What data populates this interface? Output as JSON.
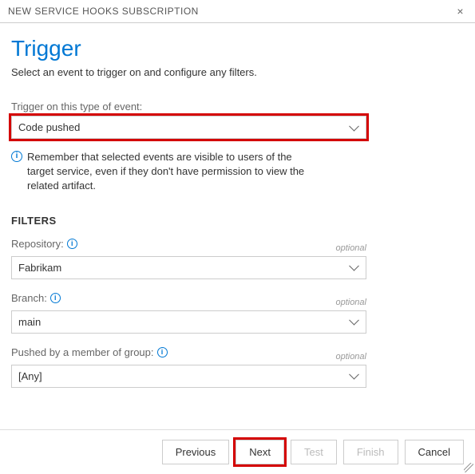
{
  "dialog": {
    "title": "NEW SERVICE HOOKS SUBSCRIPTION"
  },
  "header": {
    "title": "Trigger",
    "subtitle": "Select an event to trigger on and configure any filters."
  },
  "event": {
    "label": "Trigger on this type of event:",
    "value": "Code pushed",
    "info": "Remember that selected events are visible to users of the target service, even if they don't have permission to view the related artifact."
  },
  "filters": {
    "heading": "FILTERS",
    "optional_text": "optional",
    "repository": {
      "label": "Repository:",
      "value": "Fabrikam"
    },
    "branch": {
      "label": "Branch:",
      "value": "main"
    },
    "group": {
      "label": "Pushed by a member of group:",
      "value": "[Any]"
    }
  },
  "buttons": {
    "previous": "Previous",
    "next": "Next",
    "test": "Test",
    "finish": "Finish",
    "cancel": "Cancel"
  }
}
